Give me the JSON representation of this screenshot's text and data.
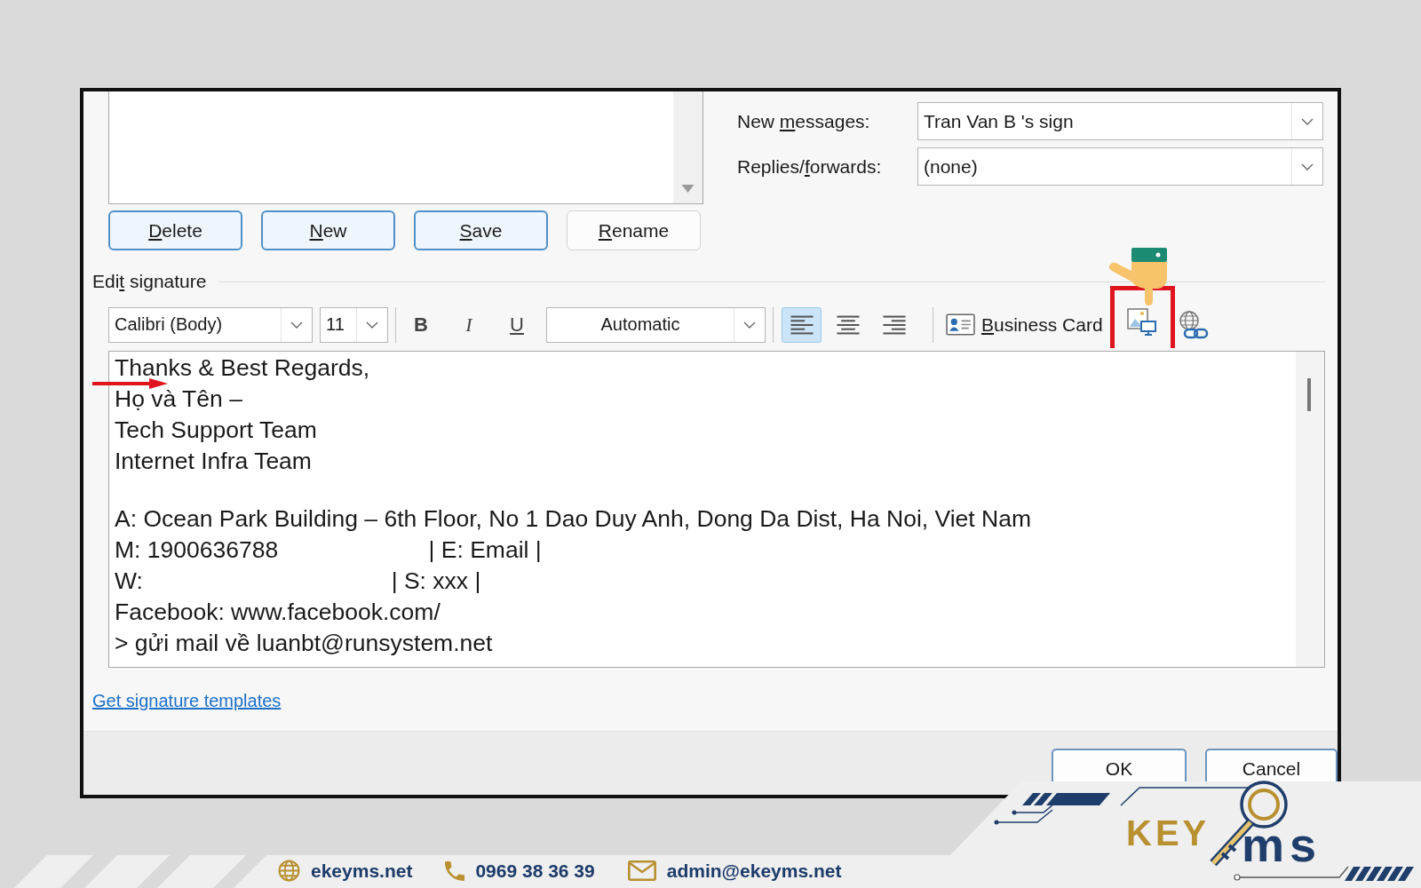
{
  "signature_buttons": [
    {
      "key": "D",
      "post": "elete",
      "kind": "accent"
    },
    {
      "key": "N",
      "post": "ew",
      "kind": "accent"
    },
    {
      "key": "S",
      "post": "ave",
      "kind": "accent"
    },
    {
      "key": "R",
      "post": "ename",
      "kind": "plain"
    }
  ],
  "default_signature": [
    {
      "label": {
        "pre": "New ",
        "key": "m",
        "post": "essages:"
      },
      "value": "Tran Van B 's sign"
    },
    {
      "label": {
        "pre": "Replies/",
        "key": "f",
        "post": "orwards:"
      },
      "value": "(none)"
    }
  ],
  "edit_signature": {
    "title": {
      "pre": "Edi",
      "key": "t",
      "post": " signature"
    },
    "toolbar": {
      "font": "Calibri (Body)",
      "size": "11",
      "format_buttons": [
        {
          "kind": "bold",
          "label": "B",
          "selected": false
        },
        {
          "kind": "italic",
          "label": "I",
          "selected": false
        },
        {
          "kind": "underline",
          "label": "U",
          "selected": false
        }
      ],
      "font_color_label": "Automatic",
      "alignment": [
        {
          "kind": "left",
          "selected": true
        },
        {
          "kind": "center",
          "selected": false
        },
        {
          "kind": "right",
          "selected": false
        }
      ],
      "business_card": {
        "key": "B",
        "post": "usiness Card"
      }
    },
    "paragraphs": [
      [
        "Thanks & Best Regards,",
        "Họ và Tên –",
        "Tech Support Team",
        "Internet Infra Team"
      ],
      [
        "A: Ocean Park Building – 6th Floor, No 1 Dao Duy Anh, Dong Da Dist, Ha Noi, Viet Nam",
        "M: 1900636788                       | E: Email |",
        "W:                                      | S: xxx |",
        "Facebook: www.facebook.com/",
        "> gửi mail về luanbt@runsystem.net"
      ]
    ]
  },
  "templates_link": "Get signature templates",
  "dialog_buttons": [
    "OK",
    "Cancel"
  ],
  "footer": {
    "contacts": [
      {
        "kind": "web",
        "text": "ekeyms.net"
      },
      {
        "kind": "phone",
        "text": "0969 38 36 39"
      },
      {
        "kind": "email",
        "text": "admin@ekeyms.net"
      }
    ],
    "logo": {
      "first": "KEY",
      "second": "ms"
    }
  }
}
